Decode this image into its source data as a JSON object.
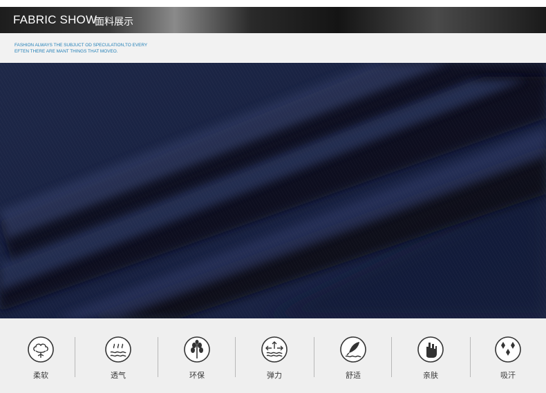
{
  "header": {
    "title": "FABRIC SHOW",
    "subtitle": "面料展示"
  },
  "tagline": {
    "line1": "FASHION ALWAYS THE  SUBJUCT OD SPECULATION,TO EVERY",
    "line2": "EFTEN THERE ARE MANT THINGS THAT MOVEO."
  },
  "photo": {
    "watermark": "",
    "colors": {
      "base": "#1b2442",
      "shadow": "#090c1c",
      "highlight": "#323d66"
    }
  },
  "features": [
    {
      "label": "柔软",
      "icon": "cotton-flower-icon"
    },
    {
      "label": "透气",
      "icon": "breathable-icon"
    },
    {
      "label": "环保",
      "icon": "tree-icon"
    },
    {
      "label": "弹力",
      "icon": "elastic-icon"
    },
    {
      "label": "舒适",
      "icon": "feather-icon"
    },
    {
      "label": "亲肤",
      "icon": "hand-icon"
    },
    {
      "label": "吸汗",
      "icon": "sweat-drops-icon"
    }
  ]
}
